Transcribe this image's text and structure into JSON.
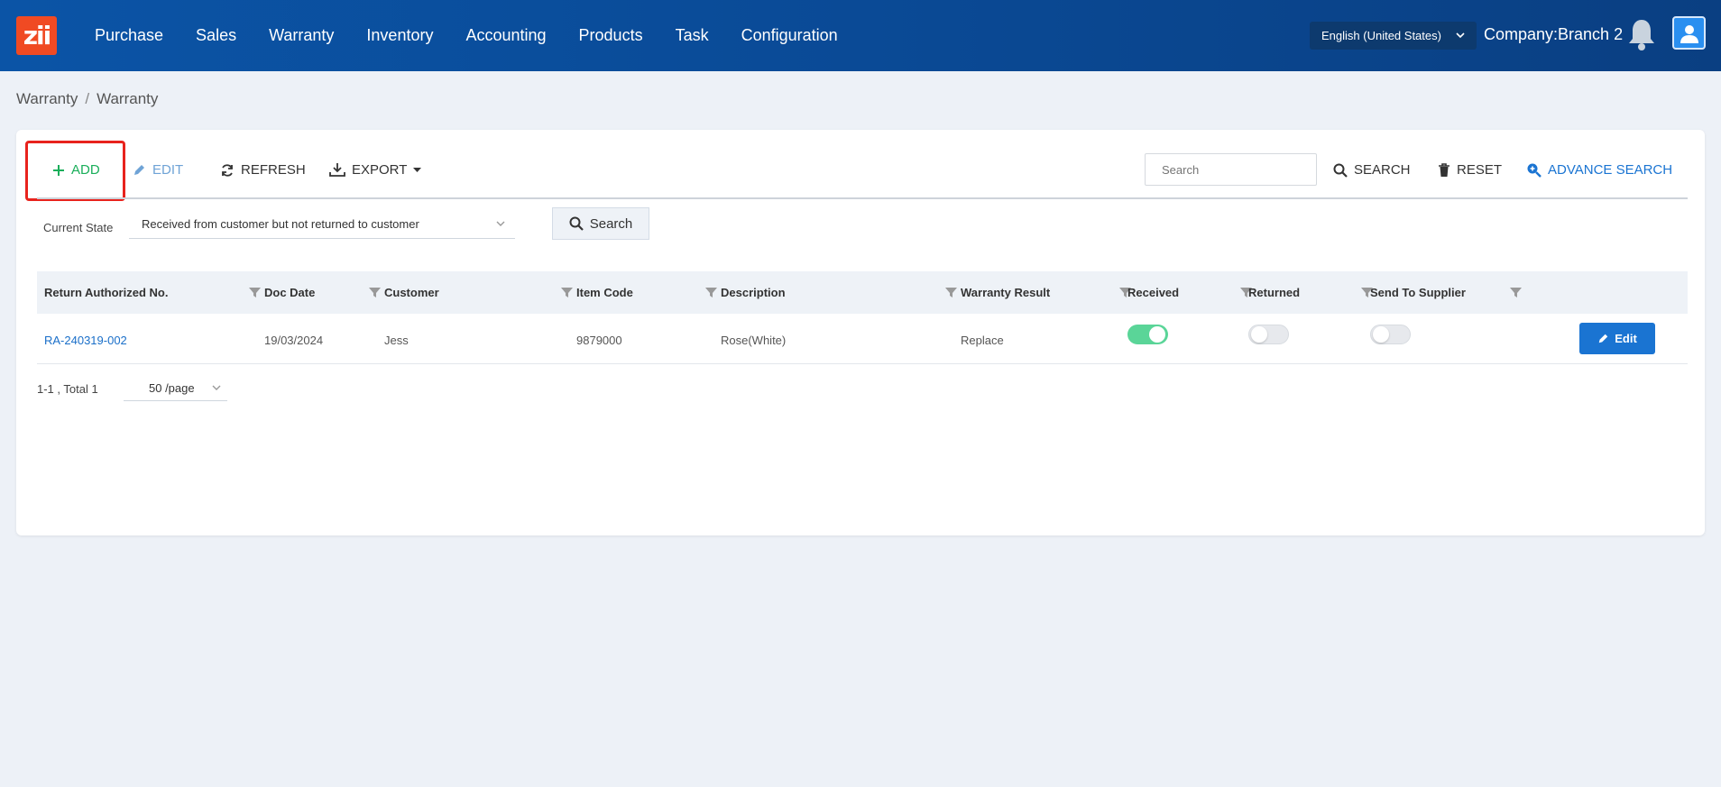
{
  "app": {
    "logo_text": "zii"
  },
  "nav": {
    "items": [
      "Purchase",
      "Sales",
      "Warranty",
      "Inventory",
      "Accounting",
      "Products",
      "Task",
      "Configuration"
    ]
  },
  "header": {
    "language": "English (United States)",
    "company": "Company:Branch 2"
  },
  "breadcrumb": {
    "items": [
      "Warranty",
      "Warranty"
    ],
    "separator": "/"
  },
  "toolbar": {
    "add_label": "ADD",
    "edit_label": "EDIT",
    "refresh_label": "REFRESH",
    "export_label": "EXPORT",
    "search_placeholder": "Search",
    "search_label": "SEARCH",
    "reset_label": "RESET",
    "advance_search_label": "ADVANCE SEARCH"
  },
  "filter": {
    "state_label": "Current State",
    "state_value": "Received from customer but not returned to customer",
    "search_button": "Search"
  },
  "table": {
    "columns": [
      "Return Authorized No.",
      "Doc Date",
      "Customer",
      "Item Code",
      "Description",
      "Warranty Result",
      "Received",
      "Returned",
      "Send To Supplier"
    ],
    "rows": [
      {
        "return_no": "RA-240319-002",
        "doc_date": "19/03/2024",
        "customer": "Jess",
        "item_code": "9879000",
        "description": "Rose(White)",
        "warranty_result": "Replace",
        "received": true,
        "returned": false,
        "send_to_supplier": false,
        "edit_label": "Edit"
      }
    ]
  },
  "pagination": {
    "info": "1-1 , Total 1",
    "page_size": "50 /page"
  },
  "colors": {
    "accent": "#1a74d2",
    "add_green": "#1aae5a",
    "highlight_red": "#e8231d",
    "toggle_on": "#5ad598"
  }
}
